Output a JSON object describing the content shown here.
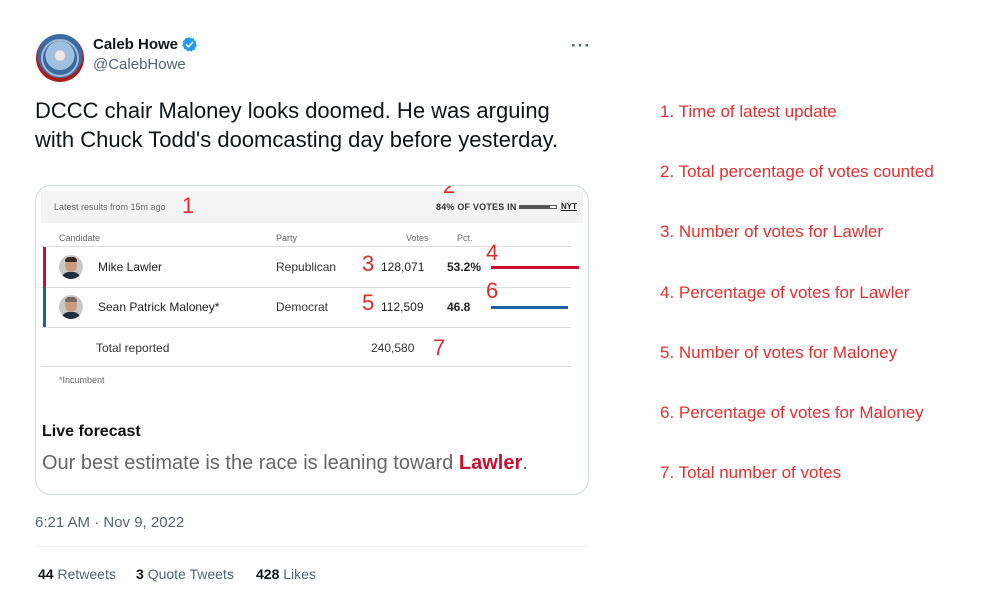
{
  "author": {
    "display_name": "Caleb Howe",
    "handle": "@CalebHowe",
    "verified_icon": "verified-badge-icon",
    "more_label": "···"
  },
  "tweet": {
    "text": "DCCC chair Maloney looks doomed. He was arguing with Chuck Todd's doomcasting day before yesterday.",
    "timestamp": "6:21 AM · Nov 9, 2022"
  },
  "results_card": {
    "latest": "Latest results from 15m ago",
    "votes_in": "84% OF VOTES IN",
    "votes_in_fraction": 0.84,
    "source": "NYT",
    "headers": {
      "candidate": "Candidate",
      "party": "Party",
      "votes": "Votes",
      "pct": "Pct."
    },
    "candidates": [
      {
        "name": "Mike Lawler",
        "party": "Republican",
        "votes": "128,071",
        "pct": "53.2%",
        "pct_value": 53.2,
        "color": "#c8102e"
      },
      {
        "name": "Sean Patrick Maloney*",
        "party": "Democrat",
        "votes": "112,509",
        "pct": "46.8",
        "pct_value": 46.8,
        "color": "#1f5fa8"
      }
    ],
    "total_label": "Total reported",
    "total_votes": "240,580",
    "incumbent_note": "*Incumbent",
    "forecast_title": "Live forecast",
    "forecast_text": "Our best estimate is the race is leaning toward ",
    "forecast_leader": "Lawler",
    "forecast_end": "."
  },
  "annotation_numbers": [
    "1",
    "2",
    "3",
    "4",
    "5",
    "6",
    "7"
  ],
  "engagement": {
    "retweets_count": "44",
    "retweets_label": "Retweets",
    "quotes_count": "3",
    "quotes_label": "Quote Tweets",
    "likes_count": "428",
    "likes_label": "Likes"
  },
  "legend": [
    "1. Time of latest update",
    "2. Total percentage of votes counted",
    "3. Number of votes for Lawler",
    "4. Percentage of votes for Lawler",
    "5. Number of votes for Maloney",
    "6. Percentage of votes for Maloney",
    "7. Total number of votes"
  ],
  "colors": {
    "annotation": "#d62d2d",
    "legend": "#e03131",
    "republican": "#c8102e",
    "democrat": "#1f5fa8",
    "verified": "#1d9bf0"
  }
}
